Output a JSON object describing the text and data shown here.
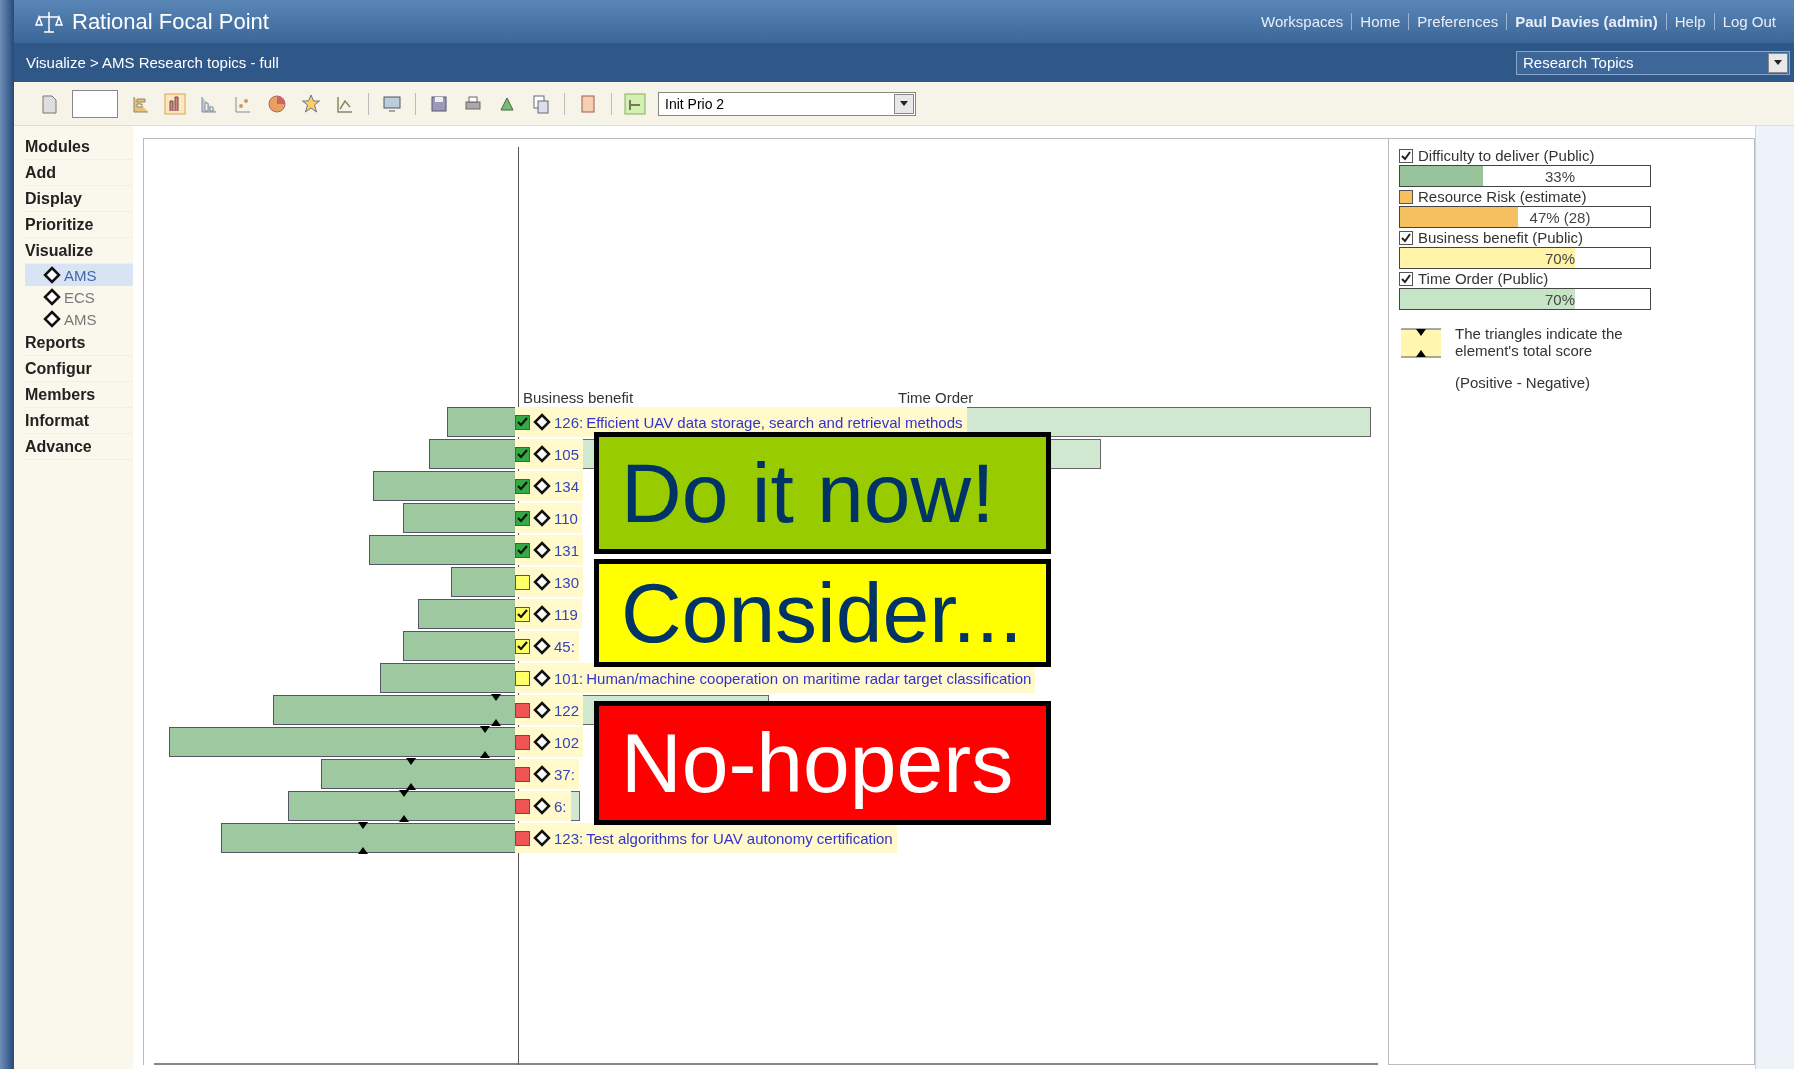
{
  "header": {
    "app_title": "Rational Focal Point",
    "links": [
      {
        "label": "Workspaces",
        "bold": false
      },
      {
        "label": "Home",
        "bold": false
      },
      {
        "label": "Preferences",
        "bold": false
      },
      {
        "label": "Paul Davies (admin)",
        "bold": true
      },
      {
        "label": "Help",
        "bold": false
      },
      {
        "label": "Log Out",
        "bold": false
      }
    ]
  },
  "breadcrumb": "Visualize > AMS Research topics - full",
  "view_select": {
    "value": "Research Topics"
  },
  "toolbar": {
    "prio_select": {
      "value": "Init Prio 2"
    }
  },
  "sidebar": {
    "items": [
      {
        "label": "Modules"
      },
      {
        "label": "Add"
      },
      {
        "label": "Display"
      },
      {
        "label": "Prioritize"
      },
      {
        "label": "Visualize",
        "children": [
          {
            "label": "AMS",
            "selected": true
          },
          {
            "label": "ECS",
            "selected": false
          },
          {
            "label": "AMS",
            "selected": false
          }
        ]
      },
      {
        "label": "Reports"
      },
      {
        "label": "Configur"
      },
      {
        "label": "Members"
      },
      {
        "label": "Informat"
      },
      {
        "label": "Advance"
      }
    ]
  },
  "chart": {
    "axis_labels": [
      "Business benefit",
      "Time Order"
    ],
    "rows": [
      {
        "id": "126:",
        "title": "Efficient UAV data storage, search and retrieval methods",
        "color": "#33aa44",
        "checked": true
      },
      {
        "id": "105",
        "color": "#33aa44",
        "checked": true
      },
      {
        "id": "134",
        "color": "#33aa44",
        "checked": true
      },
      {
        "id": "110",
        "color": "#33aa44",
        "checked": true
      },
      {
        "id": "131",
        "color": "#33aa44",
        "checked": true
      },
      {
        "id": "130",
        "color": "#ffff66",
        "checked": false
      },
      {
        "id": "119",
        "color": "#ffff66",
        "checked": true
      },
      {
        "id": "45:",
        "color": "#ffff66",
        "checked": true
      },
      {
        "id": "101:",
        "title": "Human/machine cooperation on maritime radar target classification",
        "color": "#ffff66",
        "checked": false
      },
      {
        "id": "122",
        "color": "#ee5555",
        "checked": false
      },
      {
        "id": "102",
        "color": "#ee5555",
        "checked": false
      },
      {
        "id": "37:",
        "color": "#ee5555",
        "checked": false
      },
      {
        "id": "6:",
        "color": "#ee5555",
        "checked": false
      },
      {
        "id": "123:",
        "title": "Test algorithms for UAV autonomy certification",
        "color": "#ee5555",
        "checked": false
      }
    ]
  },
  "overlays": [
    {
      "kind": "good",
      "text": "Do it now!",
      "color": "#99cc00"
    },
    {
      "kind": "maybe",
      "text": "Consider...",
      "color": "#ffff00"
    },
    {
      "kind": "bad",
      "text": "No-hopers",
      "color": "#ff0000"
    }
  ],
  "legend": {
    "criteria": [
      {
        "label": "Difficulty to deliver (Public)",
        "checked": true,
        "color": "#99c49b",
        "reading": "33%",
        "level": 0.33
      },
      {
        "label": "Resource Risk (estimate)",
        "checked": false,
        "color": "#f5c060",
        "reading": "47% (28)",
        "level": 0.47
      },
      {
        "label": "Business benefit (Public)",
        "checked": true,
        "color": "#fff4a8",
        "reading": "70%",
        "level": 0.7
      },
      {
        "label": "Time Order (Public)",
        "checked": true,
        "color": "#c6e4c6",
        "reading": "70%",
        "level": 0.7
      }
    ],
    "note": "The triangles indicate the element's total score",
    "note_sign": "(Positive - Negative)"
  }
}
